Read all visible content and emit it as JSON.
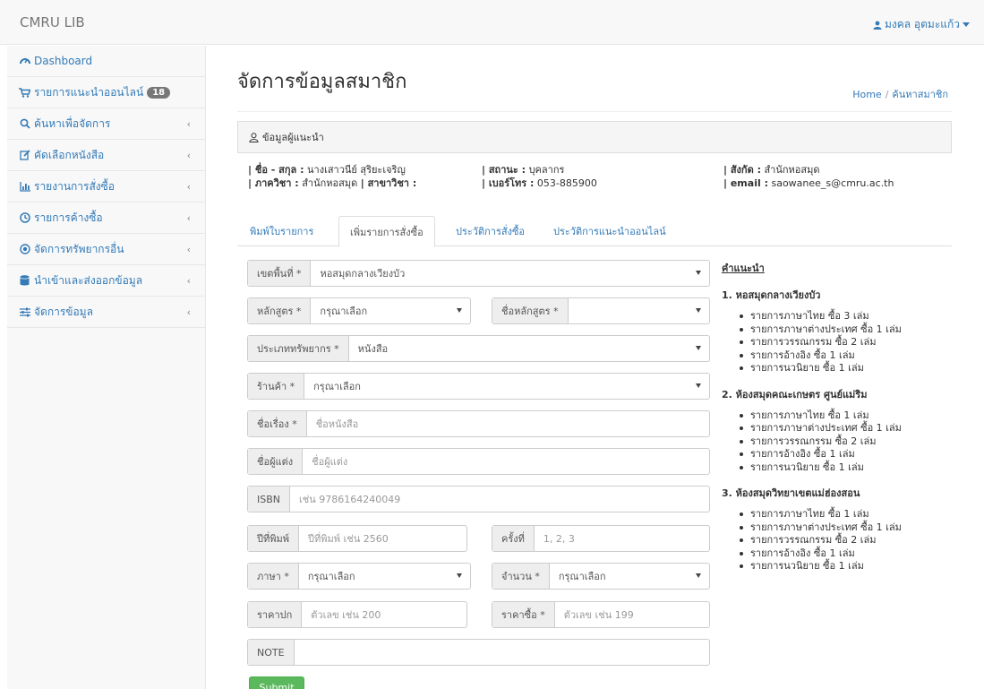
{
  "navbar": {
    "brand": "CMRU LIB",
    "user_name": "มงคล อุตมะแก้ว"
  },
  "sidebar": {
    "items": [
      {
        "label": "Dashboard",
        "icon": "dashboard-icon"
      },
      {
        "label": "รายการแนะนำออนไลน์",
        "icon": "cart-icon",
        "badge": "18"
      },
      {
        "label": "ค้นหาเพื่อจัดการ",
        "icon": "search-icon"
      },
      {
        "label": "คัดเลือกหนังสือ",
        "icon": "edit-icon"
      },
      {
        "label": "รายงานการสั่งซื้อ",
        "icon": "bar-chart-icon"
      },
      {
        "label": "รายการค้างซื้อ",
        "icon": "clock-icon"
      },
      {
        "label": "จัดการทรัพยากรอื่น",
        "icon": "target-icon"
      },
      {
        "label": "นำเข้าและส่งออกข้อมูล",
        "icon": "database-icon"
      },
      {
        "label": "จัดการข้อมูล",
        "icon": "sliders-icon"
      }
    ]
  },
  "page": {
    "title": "จัดการข้อมูลสมาชิก",
    "breadcrumb_home": "Home",
    "breadcrumb_current": "ค้นหาสมาชิก"
  },
  "panel": {
    "heading": "ข้อมูลผู้แนะนำ"
  },
  "member": {
    "name_label": "| ชื่อ - สกุล :",
    "name_value": "นางเสาวนีย์ สุริยะเจริญ",
    "dept_label": "| ภาควิชา :",
    "dept_value": "สำนักหอสมุด",
    "major_label": "| สาขาวิชา :",
    "status_label": "| สถานะ :",
    "status_value": "บุคลากร",
    "phone_label": "| เบอร์โทร :",
    "phone_value": "053-885900",
    "affil_label": "| สังกัด :",
    "affil_value": "สำนักหอสมุด",
    "email_label": "| email :",
    "email_value": "saowanee_s@cmru.ac.th"
  },
  "tabs": [
    {
      "label": "พิมพ์ใบรายการ"
    },
    {
      "label": "เพิ่มรายการสั่งซื้อ"
    },
    {
      "label": "ประวัติการสั่งซื้อ"
    },
    {
      "label": "ประวัติการแนะนำออนไลน์"
    }
  ],
  "form": {
    "zone": {
      "label": "เขตพื้นที่ *",
      "value": "หอสมุดกลางเวียงบัว"
    },
    "course": {
      "label": "หลักสูตร *",
      "value": "กรุณาเลือก"
    },
    "course_name": {
      "label": "ชื่อหลักสูตร *",
      "value": ""
    },
    "resource_type": {
      "label": "ประเภททรัพยากร *",
      "value": "หนังสือ"
    },
    "store": {
      "label": "ร้านค้า *",
      "value": "กรุณาเลือก"
    },
    "title": {
      "label": "ชื่อเรื่อง *",
      "placeholder": "ชื่อหนังสือ"
    },
    "author": {
      "label": "ชื่อผู้แต่ง",
      "placeholder": "ชื่อผู้แต่ง"
    },
    "isbn": {
      "label": "ISBN",
      "placeholder": "เช่น 9786164240049"
    },
    "year": {
      "label": "ปีที่พิมพ์",
      "placeholder": "ปีที่พิมพ์ เช่น 2560"
    },
    "edition": {
      "label": "ครั้งที่",
      "placeholder": "1, 2, 3"
    },
    "language": {
      "label": "ภาษา *",
      "value": "กรุณาเลือก"
    },
    "quantity": {
      "label": "จำนวน *",
      "value": "กรุณาเลือก"
    },
    "cover_price": {
      "label": "ราคาปก",
      "placeholder": "ตัวเลข เช่น 200"
    },
    "purchase_price": {
      "label": "ราคาซื้อ *",
      "placeholder": "ตัวเลข เช่น 199"
    },
    "note": {
      "label": "NOTE",
      "placeholder": ""
    },
    "submit_label": "Submit"
  },
  "advice": {
    "heading": "คำแนะนำ",
    "sections": [
      {
        "title": "1. หอสมุดกลางเวียงบัว",
        "items": [
          "รายการภาษาไทย ซื้อ 3 เล่ม",
          "รายการภาษาต่างประเทศ ซื้อ 1 เล่ม",
          "รายการวรรณกรรม ซื้อ 2 เล่ม",
          "รายการอ้างอิง ซื้อ 1 เล่ม",
          "รายการนวนิยาย ซื้อ 1 เล่ม"
        ]
      },
      {
        "title": "2. ห้องสมุดคณะเกษตร ศูนย์แม่ริม",
        "items": [
          "รายการภาษาไทย ซื้อ 1 เล่ม",
          "รายการภาษาต่างประเทศ ซื้อ 1 เล่ม",
          "รายการวรรณกรรม ซื้อ 2 เล่ม",
          "รายการอ้างอิง ซื้อ 1 เล่ม",
          "รายการนวนิยาย ซื้อ 1 เล่ม"
        ]
      },
      {
        "title": "3. ห้องสมุดวิทยาเขตแม่ฮ่องสอน",
        "items": [
          "รายการภาษาไทย ซื้อ 1 เล่ม",
          "รายการภาษาต่างประเทศ ซื้อ 1 เล่ม",
          "รายการวรรณกรรม ซื้อ 2 เล่ม",
          "รายการอ้างอิง ซื้อ 1 เล่ม",
          "รายการนวนิยาย ซื้อ 1 เล่ม"
        ]
      }
    ]
  },
  "colors": {
    "link": "#337ab7",
    "submit": "#5cb85c",
    "badge": "#777777"
  }
}
